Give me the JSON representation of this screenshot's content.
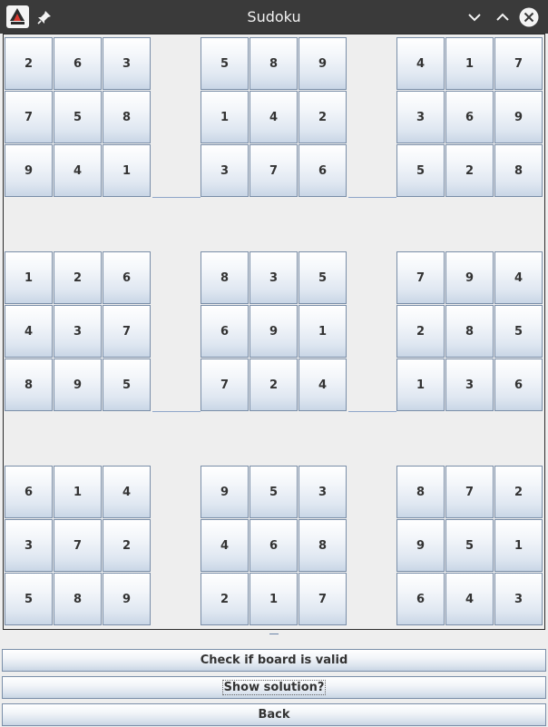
{
  "window": {
    "title": "Sudoku"
  },
  "board": {
    "boxes": [
      [
        "2",
        "6",
        "3",
        "7",
        "5",
        "8",
        "9",
        "4",
        "1"
      ],
      [
        "5",
        "8",
        "9",
        "1",
        "4",
        "2",
        "3",
        "7",
        "6"
      ],
      [
        "4",
        "1",
        "7",
        "3",
        "6",
        "9",
        "5",
        "2",
        "8"
      ],
      [
        "1",
        "2",
        "6",
        "4",
        "3",
        "7",
        "8",
        "9",
        "5"
      ],
      [
        "8",
        "3",
        "5",
        "6",
        "9",
        "1",
        "7",
        "2",
        "4"
      ],
      [
        "7",
        "9",
        "4",
        "2",
        "8",
        "5",
        "1",
        "3",
        "6"
      ],
      [
        "6",
        "1",
        "4",
        "3",
        "7",
        "2",
        "5",
        "8",
        "9"
      ],
      [
        "9",
        "5",
        "3",
        "4",
        "6",
        "8",
        "2",
        "1",
        "7"
      ],
      [
        "8",
        "7",
        "2",
        "9",
        "5",
        "1",
        "6",
        "4",
        "3"
      ]
    ]
  },
  "actions": {
    "check_label": "Check if board is valid",
    "solution_label": "Show solution?",
    "back_label": "Back"
  },
  "icons": {
    "app": "java-duke-icon",
    "pin": "pin-icon",
    "minimize": "chevron-down-icon",
    "maximize": "chevron-up-icon",
    "close": "close-icon"
  }
}
